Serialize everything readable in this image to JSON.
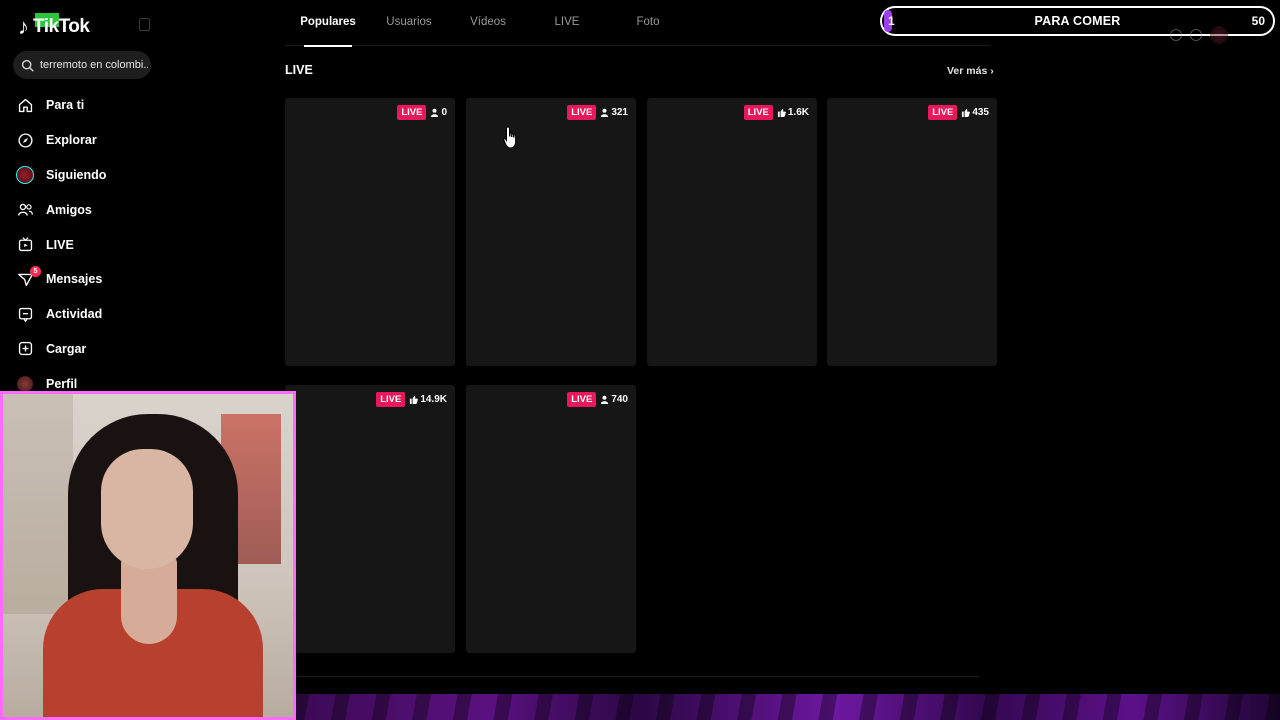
{
  "sidebar": {
    "logo_text": "TikTok",
    "search_value": "terremoto en colombi...",
    "items": [
      {
        "label": "Para ti",
        "icon": "home-icon"
      },
      {
        "label": "Explorar",
        "icon": "compass-icon"
      },
      {
        "label": "Siguiendo",
        "icon": "avatar"
      },
      {
        "label": "Amigos",
        "icon": "friends-icon"
      },
      {
        "label": "LIVE",
        "icon": "live-tv-icon"
      },
      {
        "label": "Mensajes",
        "icon": "inbox-icon",
        "badge": "5"
      },
      {
        "label": "Actividad",
        "icon": "activity-icon"
      },
      {
        "label": "Cargar",
        "icon": "upload-icon"
      },
      {
        "label": "Perfil",
        "icon": "avatar"
      }
    ]
  },
  "tabs": [
    {
      "label": "Populares",
      "active": true
    },
    {
      "label": "Usuarios",
      "active": false
    },
    {
      "label": "Vídeos",
      "active": false
    },
    {
      "label": "LIVE",
      "active": false
    },
    {
      "label": "Foto",
      "active": false
    }
  ],
  "section": {
    "title": "LIVE",
    "more_label": "Ver más"
  },
  "cards": [
    {
      "live_label": "LIVE",
      "stat_icon": "person-icon",
      "stat": "0"
    },
    {
      "live_label": "LIVE",
      "stat_icon": "person-icon",
      "stat": "321"
    },
    {
      "live_label": "LIVE",
      "stat_icon": "like-icon",
      "stat": "1.6K"
    },
    {
      "live_label": "LIVE",
      "stat_icon": "like-icon",
      "stat": "435"
    },
    {
      "live_label": "LIVE",
      "stat_icon": "like-icon",
      "stat": "14.9K"
    },
    {
      "live_label": "LIVE",
      "stat_icon": "person-icon",
      "stat": "740"
    }
  ],
  "goal_bar": {
    "start": "1",
    "label": "PARA COMER",
    "end": "50",
    "progress_fraction": 0.02
  },
  "colors": {
    "live_badge": "#e8185b",
    "webcam_border": "#ff6bff",
    "goal_fill": "#9b3df0"
  }
}
